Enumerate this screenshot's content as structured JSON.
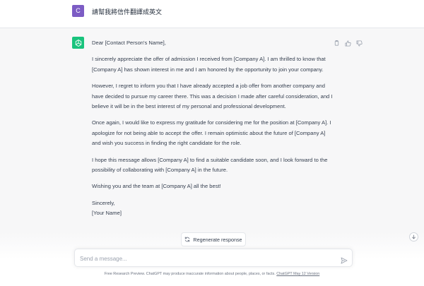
{
  "user_message": {
    "avatar_letter": "C",
    "text": "請幫我將信件翻譯成英文"
  },
  "assistant_message": {
    "paragraphs": [
      "Dear [Contact Person's Name],",
      "I sincerely appreciate the offer of admission I received from [Company A]. I am thrilled to know that [Company A] has shown interest in me and I am honored by the opportunity to join your company.",
      "However, I regret to inform you that I have already accepted a job offer from another company and have decided to pursue my career there. This was a decision I made after careful consideration, and I believe it will be in the best interest of my personal and professional development.",
      "Once again, I would like to express my gratitude for considering me for the position at [Company A]. I apologize for not being able to accept the offer. I remain optimistic about the future of [Company A] and wish you success in finding the right candidate for the role.",
      "I hope this message allows [Company A] to find a suitable candidate soon, and I look forward to the possibility of collaborating with [Company A] in the future.",
      "Wishing you and the team at [Company A] all the best!"
    ],
    "closing": "Sincerely,",
    "signature": "[Your Name]"
  },
  "regenerate_label": "Regenerate response",
  "composer": {
    "placeholder": "Send a message..."
  },
  "footer": {
    "text": "Free Research Preview. ChatGPT may produce inaccurate information about people, places, or facts.",
    "link": "ChatGPT May 12 Version"
  },
  "colors": {
    "user_avatar": "#7c5cc4",
    "assistant_avatar": "#19c37d",
    "assistant_bg": "#f7f7f8"
  },
  "icons": [
    "copy-icon",
    "thumbs-up-icon",
    "thumbs-down-icon",
    "refresh-icon",
    "arrow-down-icon",
    "send-icon",
    "openai-logo-icon"
  ]
}
